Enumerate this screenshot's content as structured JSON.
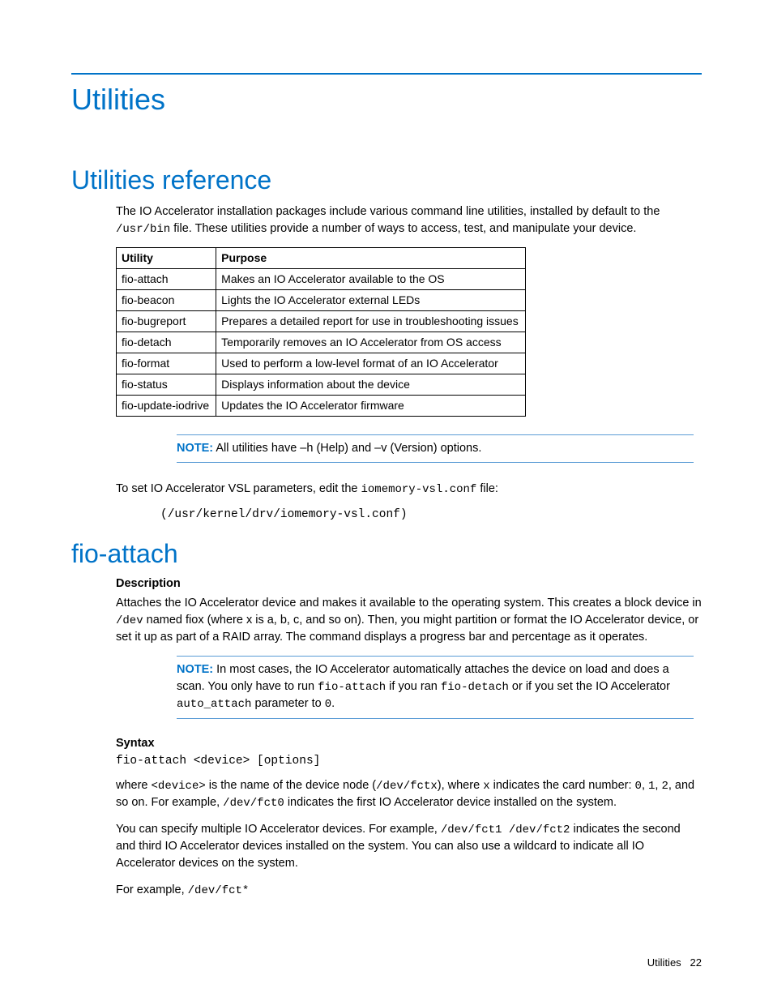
{
  "title": "Utilities",
  "section1": {
    "heading": "Utilities reference",
    "intro_pre": "The IO Accelerator installation packages include various command line utilities, installed by default to the ",
    "intro_code": "/usr/bin",
    "intro_post": " file. These utilities provide a number of ways to access, test, and manipulate your device.",
    "table_headers": {
      "utility": "Utility",
      "purpose": "Purpose"
    },
    "table_rows": [
      {
        "utility": "fio-attach",
        "purpose": "Makes an IO Accelerator available to the OS"
      },
      {
        "utility": "fio-beacon",
        "purpose": "Lights the IO Accelerator external LEDs"
      },
      {
        "utility": "fio-bugreport",
        "purpose": "Prepares a detailed report for use in troubleshooting issues"
      },
      {
        "utility": "fio-detach",
        "purpose": "Temporarily removes an IO Accelerator from OS access"
      },
      {
        "utility": "fio-format",
        "purpose": "Used to perform a low-level format of an IO Accelerator"
      },
      {
        "utility": "fio-status",
        "purpose": "Displays information about the device"
      },
      {
        "utility": "fio-update-iodrive",
        "purpose": "Updates the IO Accelerator firmware"
      }
    ],
    "note1_label": "NOTE:",
    "note1_text": "  All utilities have –h (Help) and –v (Version) options.",
    "vsl_pre": "To set IO Accelerator VSL parameters, edit the ",
    "vsl_code": "iomemory-vsl.conf",
    "vsl_post": " file:",
    "vsl_path": "(/usr/kernel/drv/iomemory-vsl.conf)"
  },
  "section2": {
    "heading": "fio-attach",
    "desc_label": "Description",
    "desc_p1a": "Attaches the IO Accelerator device and makes it available to the operating system. This creates a block device in ",
    "desc_p1_code": "/dev",
    "desc_p1b": " named fiox (where x is a, b, c, and so on). Then, you might partition or format the IO Accelerator device, or set it up as part of a RAID array. The command displays a progress bar and percentage as it operates.",
    "note2_label": "NOTE:",
    "note2_a": "  In most cases, the IO Accelerator automatically attaches the device on load and does a scan. You only have to run ",
    "note2_c1": "fio-attach",
    "note2_b": " if you ran ",
    "note2_c2": "fio-detach",
    "note2_c": " or if you set the IO Accelerator ",
    "note2_c3": "auto_attach",
    "note2_d": " parameter to ",
    "note2_c4": "0",
    "note2_e": ".",
    "syntax_label": "Syntax",
    "syntax_code": "fio-attach <device> [options]",
    "where_a": "where ",
    "where_c1": "<device>",
    "where_b": " is the name of the device node (",
    "where_c2": "/dev/fctx",
    "where_c": "), where ",
    "where_c3": "x",
    "where_d": " indicates the card number: ",
    "where_c4": "0",
    "where_e": ", ",
    "where_c5": "1",
    "where_f": ", ",
    "where_c6": "2",
    "where_g": ", and so on. For example, ",
    "where_c7": "/dev/fct0",
    "where_h": " indicates the first IO Accelerator device installed on the system.",
    "multi_a": "You can specify multiple IO Accelerator devices. For example, ",
    "multi_c1": "/dev/fct1 /dev/fct2",
    "multi_b": " indicates the second and third IO Accelerator devices installed on the system. You can also use a wildcard to indicate all IO Accelerator devices on the system.",
    "example_a": "For example, ",
    "example_c1": "/dev/fct*"
  },
  "footer": {
    "label": "Utilities",
    "page": "22"
  }
}
